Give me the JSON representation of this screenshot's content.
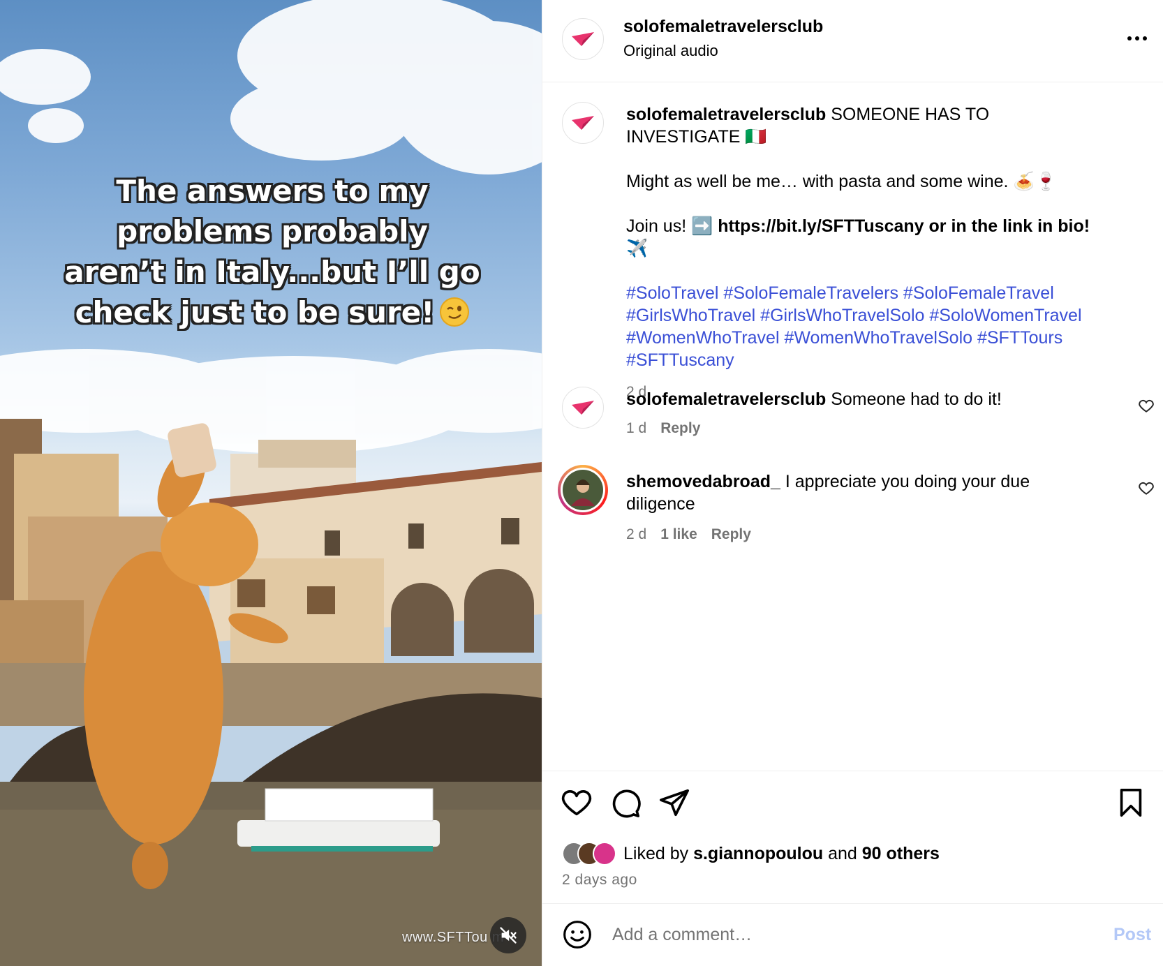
{
  "media": {
    "overlay_lines": [
      "The answers to my",
      "problems probably",
      "aren’t in Italy...but I’ll go",
      "check just to be sure!"
    ],
    "overlay_emoji": "wink-emoji",
    "watermark": "www.SFTTou   m",
    "mute_icon": "speaker-muted-icon"
  },
  "header": {
    "username": "solofemaletravelersclub",
    "audio": "Original audio",
    "more_icon": "more-dots-icon",
    "avatar_icon": "paper-plane-logo"
  },
  "caption": {
    "username": "solofemaletravelersclub",
    "line1": "SOMEONE HAS TO INVESTIGATE 🇮🇹",
    "line2": "Might as well be me… with pasta and some wine. 🍝🍷",
    "line3_prefix": "Join us! ➡️ ",
    "line3_bold": "https://bit.ly/SFTTuscany or in the link in bio!",
    "line3_suffix": " ✈️",
    "hashtags": "#SoloTravel #SoloFemaleTravelers #SoloFemaleTravel #GirlsWhoTravel #GirlsWhoTravelSolo #SoloWomenTravel #WomenWhoTravel #WomenWhoTravelSolo #SFTTours #SFTTuscany",
    "time": "2 d"
  },
  "comments": [
    {
      "username": "solofemaletravelersclub",
      "text": "Someone had to do it!",
      "time": "1 d",
      "likes": "",
      "reply": "Reply"
    },
    {
      "username": "shemovedabroad_",
      "text": "I appreciate you doing your due diligence",
      "time": "2 d",
      "likes": "1 like",
      "reply": "Reply"
    }
  ],
  "actions": {
    "icons": [
      "heart-icon",
      "comment-icon",
      "share-icon",
      "bookmark-icon"
    ],
    "liked_prefix": "Liked by ",
    "liked_user": "s.giannopoulou",
    "liked_middle": " and ",
    "liked_others": "90 others",
    "date": "2 days ago"
  },
  "comment_box": {
    "placeholder": "Add a comment…",
    "post_label": "Post"
  },
  "colors": {
    "brand_pink": "#e8336d",
    "hashtag_blue": "#3a4fd6",
    "muted_gray": "#737373",
    "post_disabled": "#b3c8f7"
  }
}
